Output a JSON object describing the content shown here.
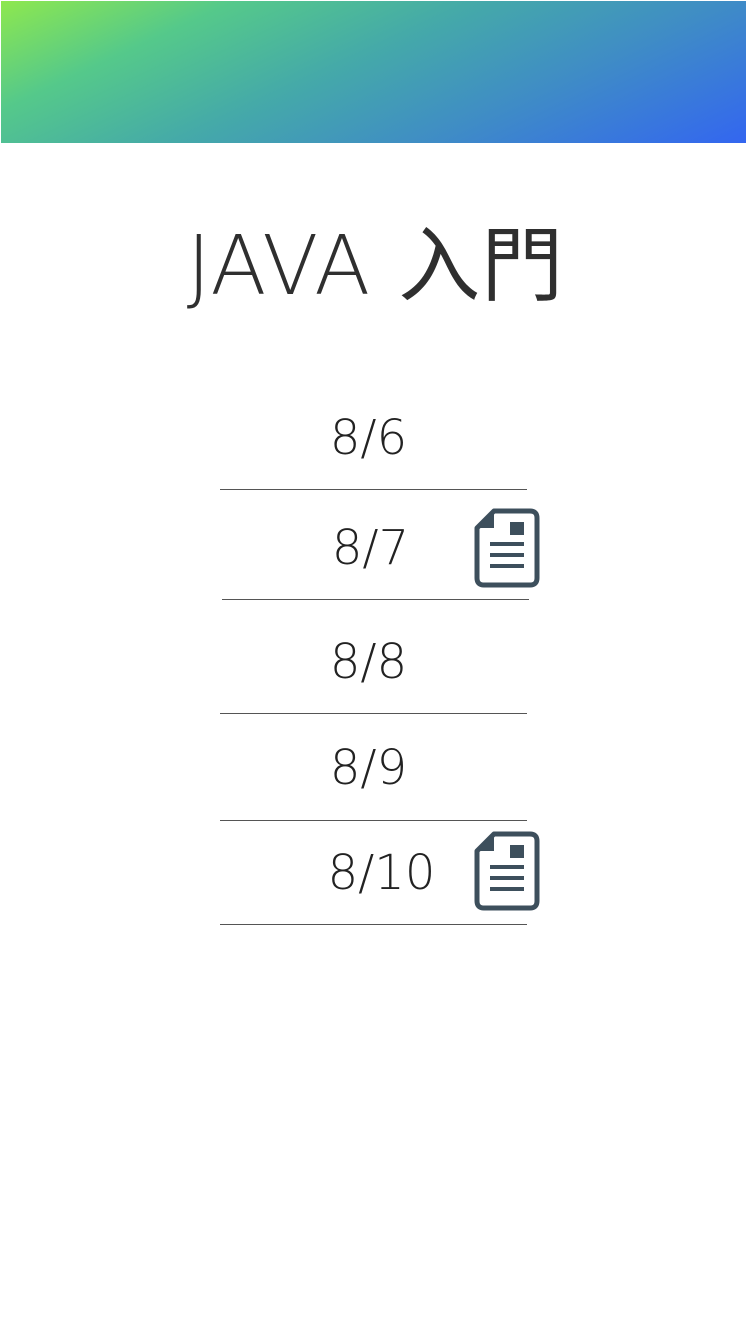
{
  "header": {
    "gradient_start": "#8ee84e",
    "gradient_end": "#3366f0"
  },
  "page": {
    "title": "JAVA 入門"
  },
  "dates": [
    {
      "label": "8/6",
      "has_note": false
    },
    {
      "label": "8/7",
      "has_note": true,
      "note_icon": "document-icon"
    },
    {
      "label": "8/8",
      "has_note": false
    },
    {
      "label": "8/9",
      "has_note": false
    },
    {
      "label": "8/10",
      "has_note": true,
      "note_icon": "document-icon"
    }
  ],
  "colors": {
    "icon": "#3d4f5c",
    "divider": "#555555",
    "text": "#222222"
  }
}
